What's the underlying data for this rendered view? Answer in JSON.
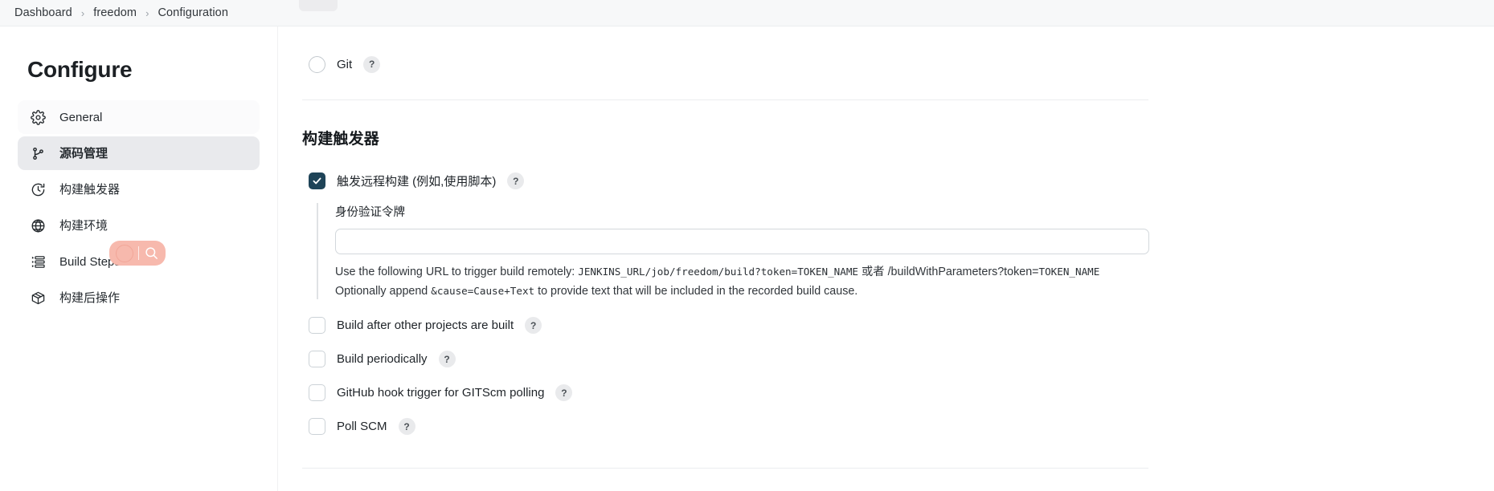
{
  "breadcrumb": {
    "items": [
      {
        "label": "Dashboard"
      },
      {
        "label": "freedom"
      },
      {
        "label": "Configuration"
      }
    ],
    "separator": "›"
  },
  "sidebar": {
    "title": "Configure",
    "items": [
      {
        "label": "General",
        "icon": "gear-icon",
        "state": "subtle",
        "key": "general"
      },
      {
        "label": "源码管理",
        "icon": "git-branch-icon",
        "state": "active",
        "key": "source-code-management"
      },
      {
        "label": "构建触发器",
        "icon": "clock-icon",
        "state": "normal",
        "key": "build-triggers"
      },
      {
        "label": "构建环境",
        "icon": "globe-icon",
        "state": "normal",
        "key": "build-environment"
      },
      {
        "label": "Build Steps",
        "icon": "list-icon",
        "state": "normal",
        "key": "build-steps"
      },
      {
        "label": "构建后操作",
        "icon": "box-icon",
        "state": "normal",
        "key": "post-build-actions"
      }
    ]
  },
  "overlay": {
    "name": "search-cursor-overlay",
    "color": "#f7b9ad",
    "icon": "magnifier-icon"
  },
  "scm": {
    "git_option": {
      "label": "Git",
      "checked": false,
      "help": "?"
    }
  },
  "triggers": {
    "heading": "构建触发器",
    "help_glyph": "?",
    "items": [
      {
        "label": "触发远程构建 (例如,使用脚本)",
        "checked": true,
        "key": "trigger-remote-build"
      },
      {
        "label": "Build after other projects are built",
        "checked": false,
        "key": "build-after-other-projects"
      },
      {
        "label": "Build periodically",
        "checked": false,
        "key": "build-periodically"
      },
      {
        "label": "GitHub hook trigger for GITScm polling",
        "checked": false,
        "key": "github-hook-trigger"
      },
      {
        "label": "Poll SCM",
        "checked": false,
        "key": "poll-scm"
      }
    ],
    "token": {
      "label": "身份验证令牌",
      "value": "",
      "placeholder": "",
      "help_line1_a": "Use the following URL to trigger build remotely: ",
      "help_line1_code1": "JENKINS_URL/job/freedom/build?token=TOKEN_NAME",
      "help_line1_mid": " 或者 ",
      "help_line1_b": "/buildWithParameters?token=",
      "help_line1_code2": "TOKEN_NAME",
      "help_line2_a": "Optionally append ",
      "help_line2_code": "&cause=Cause+Text",
      "help_line2_b": " to provide text that will be included in the recorded build cause."
    }
  }
}
